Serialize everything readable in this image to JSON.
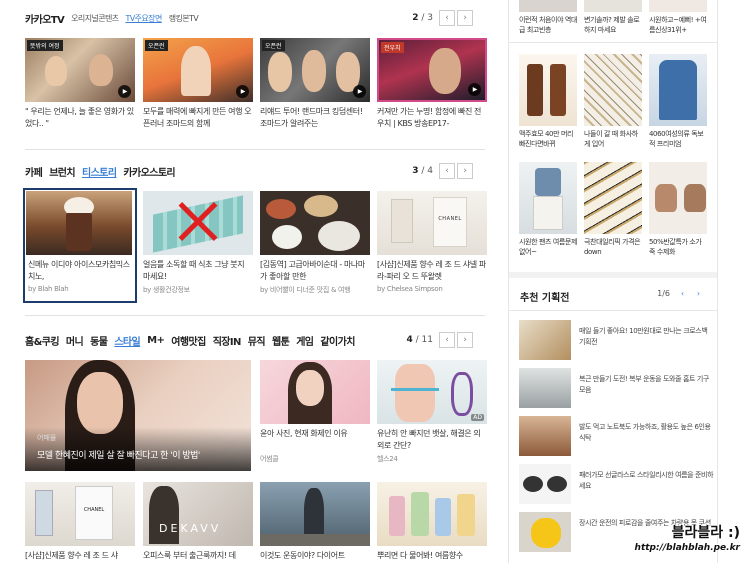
{
  "kakaotv": {
    "tabs": [
      "카카오TV",
      "오리지널콘텐츠",
      "TV주요장면",
      "랭킹본TV"
    ],
    "page_current": "2",
    "page_total": "/ 3",
    "cards": [
      {
        "badge": "뜻밖의 여정",
        "caption": "\" 우리는 언제나, 늘 좋은 영화가 있었다.. \""
      },
      {
        "badge": "오픈런",
        "caption": "모두를 매력에 빠지게 만든 여행 오픈러너 조마드의 함께"
      },
      {
        "badge": "오픈런",
        "caption": "리얘드 투어! 랜드마크 킹덤센터! 조마드가 알려주는"
      },
      {
        "badge": "전우치",
        "caption": "커져만 가는 누명! 함정에 빠진 전우치 | KBS 방송EP17-"
      }
    ]
  },
  "cafe": {
    "tabs": [
      "카페",
      "브런치",
      "티스토리",
      "카카오스토리"
    ],
    "page_current": "3",
    "page_total": "/ 4",
    "cards": [
      {
        "caption": "신메뉴 이디야 아이스모카칩믹스치노,",
        "source": "by Blah Blah"
      },
      {
        "caption": "얼음틀 소독할 때 식초 그냥 붓지 마세요!",
        "source": "by 생활건강정보"
      },
      {
        "caption": "[김동역] 고급아바이순대 - 마나마가 좋아할 만한",
        "source": "by 비어빨이 디너준 맛집 & 여행"
      },
      {
        "caption": "[사샵]신제품 향수 레 조 드 샤넬 파라-파리 오 드 뚜왈렛",
        "source": "by Chelsea Simpson"
      }
    ]
  },
  "home": {
    "tabs": [
      "홈&쿠킹",
      "머니",
      "동물",
      "스타일",
      "M+",
      "여행맛집",
      "직장IN",
      "뮤직",
      "웹툰",
      "게임",
      "같이가치"
    ],
    "page_current": "4",
    "page_total": "/ 11",
    "big_card": {
      "source": "어패뮬",
      "caption": "모델 한혜진이 제일 살 잘 빠진다고 한 '이 방법'"
    },
    "cards_mid": [
      {
        "caption": "윤아 사진, 현재 화제인 이유",
        "source": "어썸클"
      },
      {
        "caption": "유난히 안 빠지던 뱃살, 해결은 의외로 간단?",
        "source": "헬스24"
      }
    ],
    "cards_bottom": [
      {
        "caption": "[사샵]신제품 향수 레 조 드 샤"
      },
      {
        "caption": "오피스룩 부터 출근룩까지! 데"
      },
      {
        "caption": "이것도 운동이야? 다이어트"
      },
      {
        "caption": "뿌리면 다 물어봐! 여름향수"
      }
    ]
  },
  "shopping": {
    "top_captions": [
      "이런적 처음이야 역대급 최고빈층",
      "변기솔까? 제발 솔로하지 마세요",
      "시원하고~예뻐! +여름신상31위+"
    ],
    "grid": [
      {
        "caption": "맥주효모 40만 머리빠진다면바뀌"
      },
      {
        "caption": "나들이 갈 때 화사하게 입어"
      },
      {
        "caption": "4060여성의류 독보적 프리미엄"
      },
      {
        "caption": "시원한 팬츠 여름문제없어~"
      },
      {
        "caption": "극찬대일리픽 가격은down"
      },
      {
        "caption": "50%반값특가 소가죽 수제화"
      }
    ]
  },
  "recommend": {
    "title": "추천 기획전",
    "page": "1/6",
    "items": [
      {
        "caption": "매일 들기 좋아요! 10만원대로 만나는 크로스백 기획전"
      },
      {
        "caption": "복근 만들기 도전! 복부 운동을 도와줄 홈트 기구 모음"
      },
      {
        "caption": "발도 먹고 노트북도 가능하죠, 활용도 높은 6인용 식탁"
      },
      {
        "caption": "패러가모 선글라스로 스타일리시한 여름을 준비하세요"
      },
      {
        "caption": "장시간 운전의 피로감을 줄여주는 차량용 목 쿠션"
      }
    ]
  },
  "watermark": {
    "line1": "블라블라 :)",
    "line2": "http://blahblah.pe.kr"
  },
  "icons": {
    "prev": "‹",
    "next": "›",
    "play": "▶"
  },
  "colors": {
    "accent": "#3a7fd5",
    "selected_border": "#1d3c6b"
  }
}
